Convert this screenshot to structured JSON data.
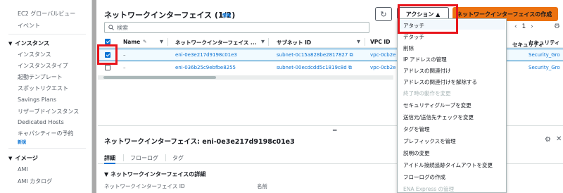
{
  "sidebar": {
    "ec2_global_view": "EC2 グローバルビュー",
    "events": "イベント",
    "instances_section": "インスタンス",
    "instances": "インスタンス",
    "instance_types": "インスタンスタイプ",
    "launch_templates": "起動テンプレート",
    "spot_requests": "スポットリクエスト",
    "savings_plans": "Savings Plans",
    "reserved_instances": "リザーブドインスタンス",
    "dedicated_hosts": "Dedicated Hosts",
    "capacity_reservations": "キャパシティーの予約",
    "new_badge": "新規",
    "images_section": "イメージ",
    "ami": "AMI",
    "ami_catalog": "AMI カタログ"
  },
  "header": {
    "title": "ネットワークインターフェイス (1/2)",
    "info": "情報",
    "refresh_icon": "refresh-icon",
    "actions_label": "アクション ▲",
    "create_label": "ネットワークインターフェイスの作成"
  },
  "search": {
    "placeholder": "検索"
  },
  "pager": {
    "prev": "‹",
    "page": "1",
    "next": "›"
  },
  "table": {
    "columns": [
      "Name",
      "ネットワークインターフェイス ...",
      "サブネット ID",
      "VPC ID",
      "セキュリティ"
    ],
    "rows": [
      {
        "selected": true,
        "name": "–",
        "eni": "eni-0e3e217d9198c01e3",
        "subnet": "subnet-0c15a828be2817827",
        "vpc": "vpc-0cb2e",
        "sg": "Security_Gro"
      },
      {
        "selected": false,
        "name": "–",
        "eni": "eni-036b25c9ebfbe8255",
        "subnet": "subnet-00ecdcdd5c1819c8d",
        "vpc": "vpc-0cb2e",
        "sg": "Security_Gro"
      }
    ]
  },
  "actions_menu": {
    "items": [
      {
        "label": "アタッチ",
        "disabled": false
      },
      {
        "label": "デタッチ",
        "disabled": false
      },
      {
        "label": "削除",
        "disabled": false
      },
      {
        "label": "IP アドレスの管理",
        "disabled": false
      },
      {
        "label": "アドレスの関連付け",
        "disabled": false
      },
      {
        "label": "アドレスの関連付けを解除する",
        "disabled": false
      },
      {
        "label": "終了時の動作を変更",
        "disabled": true
      },
      {
        "label": "セキュリティグループを変更",
        "disabled": false
      },
      {
        "label": "送信元/送信先チェックを変更",
        "disabled": false
      },
      {
        "label": "タグを管理",
        "disabled": false
      },
      {
        "label": "プレフィックスを管理",
        "disabled": false
      },
      {
        "label": "説明の変更",
        "disabled": false
      },
      {
        "label": "アイドル接続追跡タイムアウトを変更",
        "disabled": false
      },
      {
        "label": "フローログの作成",
        "disabled": false
      },
      {
        "label": "ENA Express の管理",
        "disabled": true
      }
    ]
  },
  "detail": {
    "title": "ネットワークインターフェイス: eni-0e3e217d9198c01e3",
    "tabs": [
      "詳細",
      "フローログ",
      "タグ"
    ],
    "section": "ネットワークインターフェイスの詳細",
    "field_1": "ネットワークインターフェイス ID",
    "field_2": "名前"
  },
  "colors": {
    "accent": "#0972d3",
    "primary_button": "#ec7211",
    "highlight": "#e8151c"
  }
}
